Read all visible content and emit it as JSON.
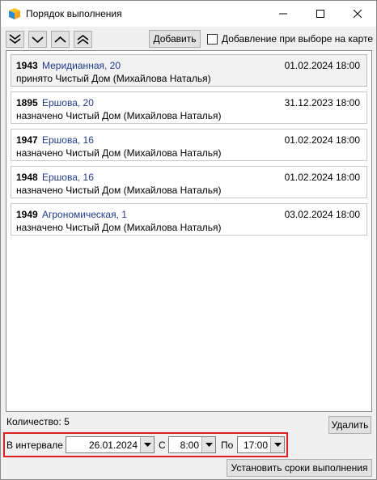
{
  "window": {
    "title": "Порядок выполнения"
  },
  "toolbar": {
    "add_label": "Добавить",
    "add_on_select_label": "Добавление при выборе на карте",
    "add_on_select_checked": false
  },
  "orders": [
    {
      "number": "1943",
      "address": "Меридианная, 20",
      "date": "01.02.2024 18:00",
      "status": "принято Чистый Дом (Михайлова Наталья)"
    },
    {
      "number": "1895",
      "address": "Ершова, 20",
      "date": "31.12.2023 18:00",
      "status": "назначено Чистый Дом (Михайлова Наталья)"
    },
    {
      "number": "1947",
      "address": "Ершова, 16",
      "date": "01.02.2024 18:00",
      "status": "назначено Чистый Дом (Михайлова Наталья)"
    },
    {
      "number": "1948",
      "address": "Ершова, 16",
      "date": "01.02.2024 18:00",
      "status": "назначено Чистый Дом (Михайлова Наталья)"
    },
    {
      "number": "1949",
      "address": "Агрономическая, 1",
      "date": "03.02.2024 18:00",
      "status": "назначено Чистый Дом (Михайлова Наталья)"
    }
  ],
  "footer": {
    "count_label": "Количество: 5",
    "delete_label": "Удалить",
    "interval_label": "В интервале",
    "date_value": "26.01.2024",
    "from_label": "С",
    "from_value": "8:00",
    "to_label": "По",
    "to_value": "17:00",
    "set_deadlines_label": "Установить сроки выполнения"
  }
}
